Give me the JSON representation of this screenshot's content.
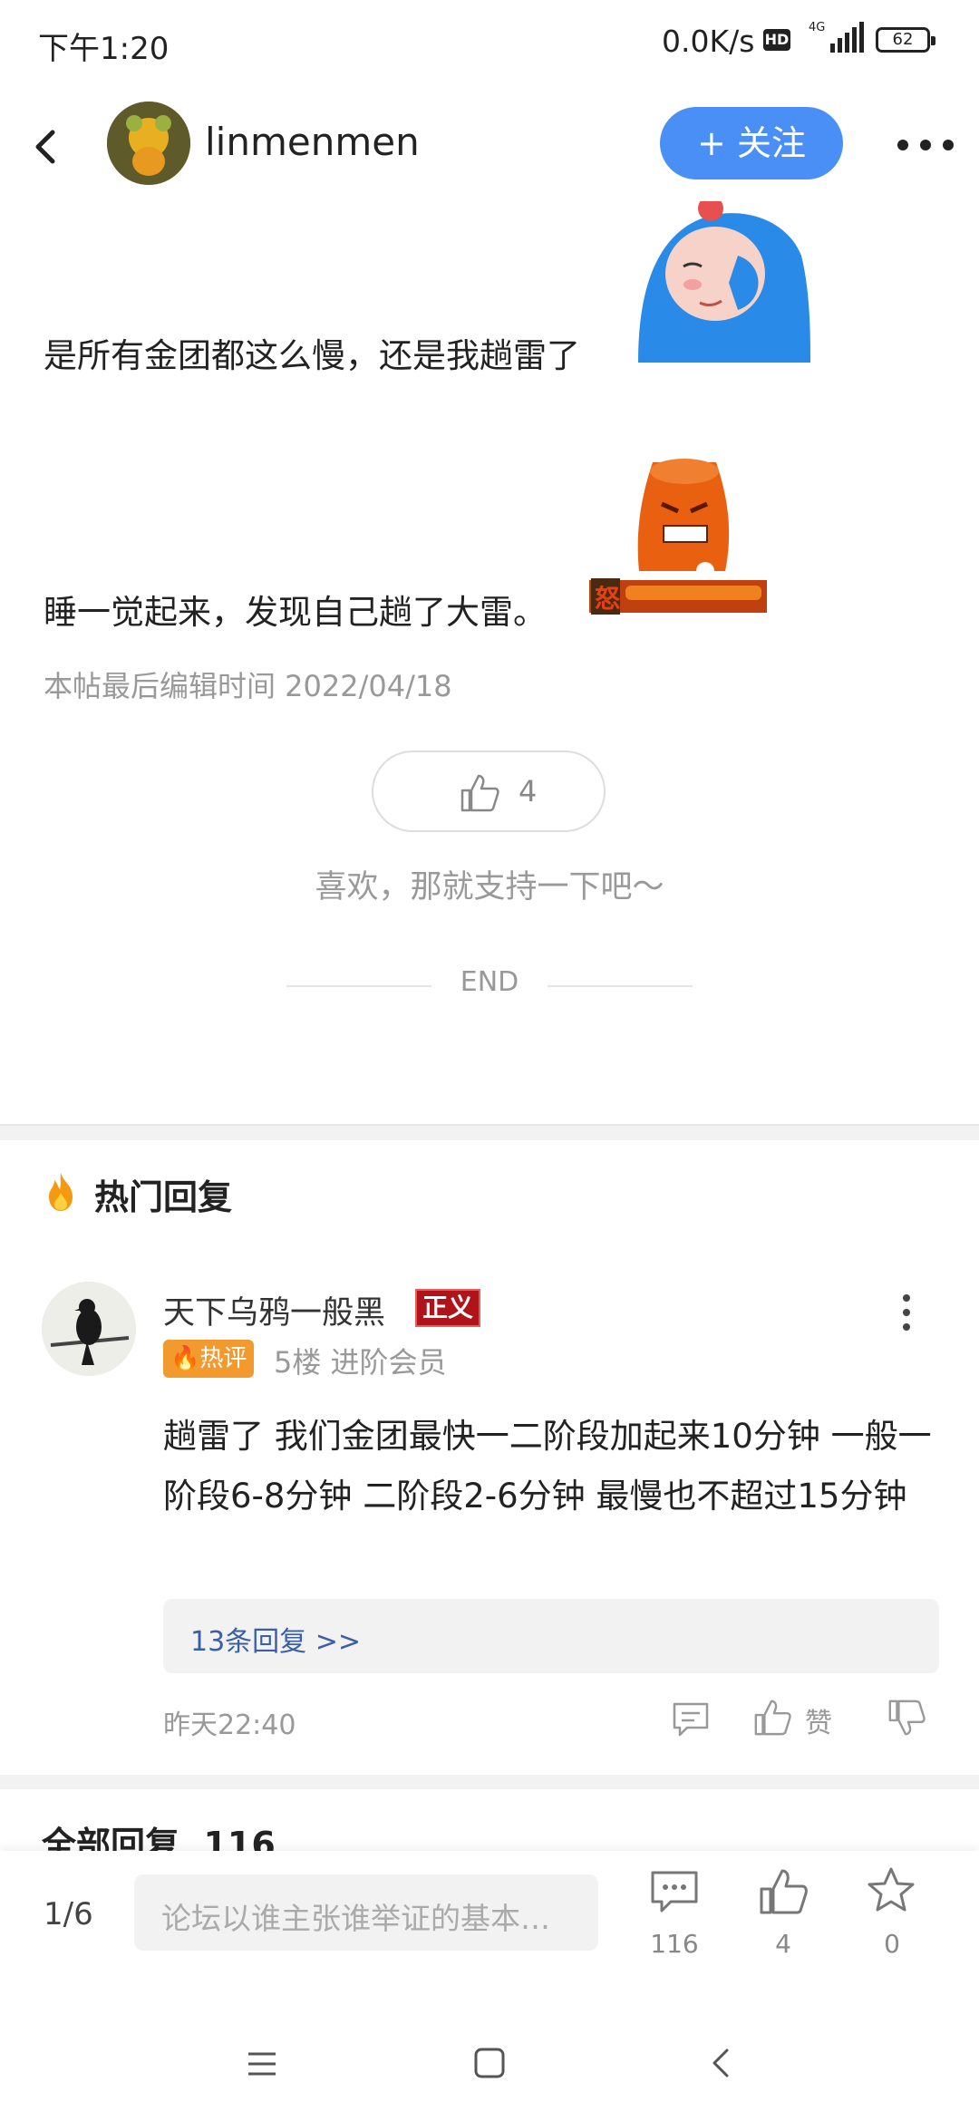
{
  "status_bar": {
    "time": "下午1:20",
    "network_speed": "0.0K/s",
    "hd_badge": "HD",
    "network_type": "4G",
    "battery": "62"
  },
  "header": {
    "author": "linmenmen",
    "follow_label": "+ 关注"
  },
  "post": {
    "paragraph1": "是所有金团都这么慢，还是我趟雷了",
    "paragraph2": "睡一觉起来，发现自己趟了大雷。",
    "edit_time": "本帖最后编辑时间 2022/04/18",
    "like_count": "4",
    "like_hint": "喜欢，那就支持一下吧～",
    "end_label": "END",
    "sticker2_text": "怒"
  },
  "hot_replies": {
    "title": "热门回复",
    "comment": {
      "username": "天下乌鸦一般黑",
      "badge": "正义",
      "hot_tag": "热评",
      "meta": "5楼 进阶会员",
      "text": "趟雷了 我们金团最快一二阶段加起来10分钟  一般一阶段6-8分钟 二阶段2-6分钟  最慢也不超过15分钟",
      "sub_replies": "13条回复 >>",
      "time": "昨天22:40",
      "like_label": "赞"
    }
  },
  "all_replies": {
    "label": "全部回复",
    "count": "116"
  },
  "bottom_bar": {
    "page_indicator": "1/6",
    "input_placeholder": "论坛以谁主张谁举证的基本…",
    "comment_count": "116",
    "like_count": "4",
    "favorite_count": "0"
  },
  "colors": {
    "accent": "#4a8ff5",
    "link": "#3b5fa6",
    "hot_tag": "#f39a2e",
    "badge_red": "#b0141a"
  }
}
